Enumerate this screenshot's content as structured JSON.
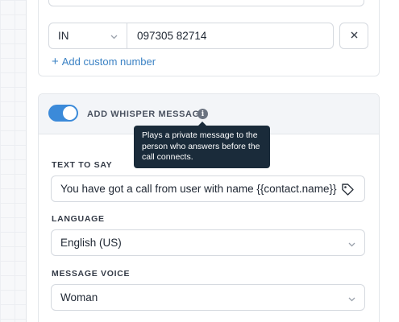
{
  "phone_row": {
    "country_code": "IN",
    "phone_number": "097305 82714",
    "add_custom_label": "Add custom number"
  },
  "whisper": {
    "toggle_on": true,
    "title": "ADD WHISPER MESSAGE",
    "info_icon_glyph": "i",
    "tooltip": "Plays a private message to the person who answers before the call connects.",
    "text_label": "TEXT TO SAY",
    "text_value": "You have got a call from user with name {{contact.name}}",
    "language_label": "LANGUAGE",
    "language_value": "English (US)",
    "voice_label": "MESSAGE VOICE",
    "voice_value": "Woman"
  },
  "icons": {
    "country_chevron": "chevron-down-icon",
    "remove": "close-icon",
    "add": "plus-icon",
    "info": "info-icon",
    "tag": "tag-icon"
  },
  "colors": {
    "accent": "#3b8ad9",
    "link": "#3b82c4",
    "tooltip_bg": "#1a2b3a"
  }
}
